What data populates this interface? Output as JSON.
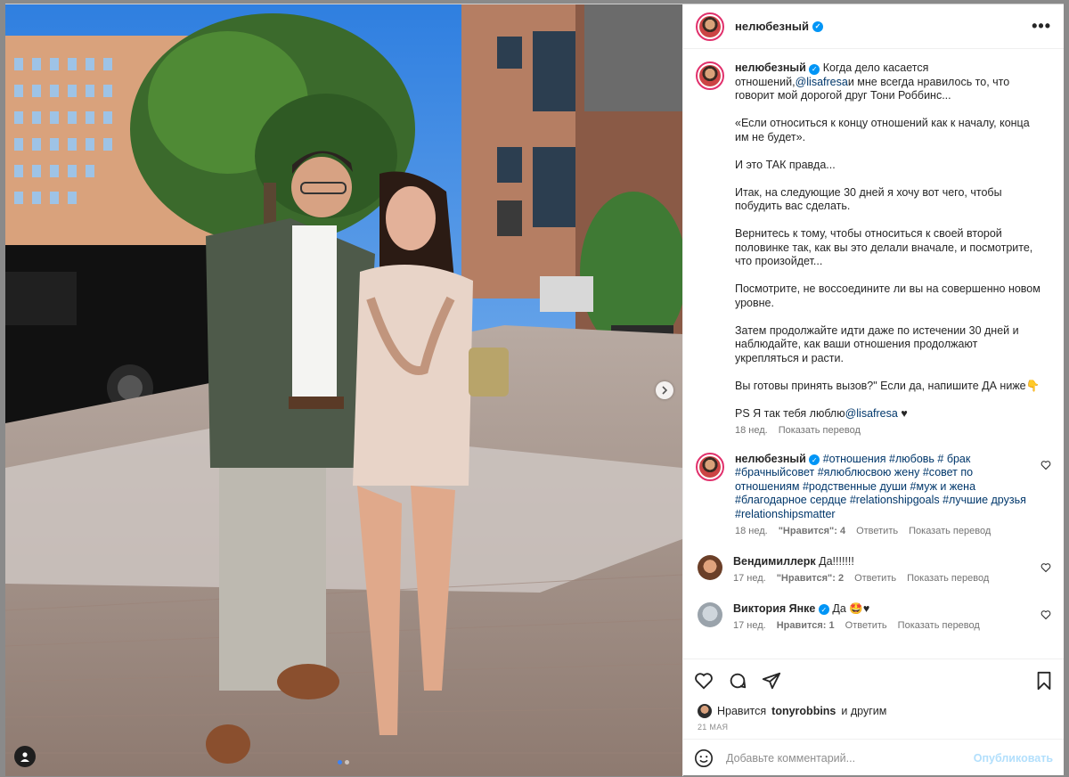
{
  "post": {
    "author": "нелюбезный",
    "more_label": "•••"
  },
  "caption": {
    "author": "нелюбезный",
    "intro": "Когда дело касается отношений,",
    "mention1": "@lisafresa",
    "intro_rest": "и мне всегда нравилось то, что говорит мой дорогой друг Тони Роббинс...",
    "p2": "«Если относиться к концу отношений как к началу, конца им не будет».",
    "p3": "И это ТАК правда...",
    "p4": "Итак, на следующие 30 дней я хочу вот чего, чтобы побудить вас сделать.",
    "p5": "Вернитесь к тому, чтобы относиться к своей второй половинке так, как вы это делали вначале, и посмотрите, что произойдет...",
    "p6": "Посмотрите, не воссоедините ли вы на совершенно новом уровне.",
    "p7": "Затем продолжайте идти даже по истечении 30 дней и наблюдайте, как ваши отношения продолжают укрепляться и расти.",
    "p8": "Вы готовы принять вызов?\" Если да, напишите ДА ниже👇",
    "ps_prefix": "PS Я так тебя люблю",
    "ps_mention": "@lisafresa",
    "ps_suffix": " ♥",
    "time": "18 нед.",
    "translate": "Показать перевод"
  },
  "comments": [
    {
      "author": "нелюбезный",
      "verified": true,
      "text": "#отношения #любовь # брак #брачныйсовет #ялюблюсвою жену #совет по отношениям #родственные души #муж и жена #благодарное сердце #relationshipgoals #лучшие друзья #relationshipsmatter",
      "time": "18 нед.",
      "likes": "\"Нравится\": 4",
      "reply": "Ответить",
      "translate": "Показать перевод"
    },
    {
      "author": "Вендимиллерк",
      "verified": false,
      "text": "Да!!!!!!!",
      "time": "17 нед.",
      "likes": "\"Нравится\": 2",
      "reply": "Ответить",
      "translate": "Показать перевод"
    },
    {
      "author": "Виктория Янке",
      "verified": true,
      "text": "Да 🤩♥",
      "time": "17 нед.",
      "likes": "Нравится: 1",
      "reply": "Ответить",
      "translate": "Показать перевод"
    }
  ],
  "likes_line": {
    "prefix": "Нравится",
    "user": "tonyrobbins",
    "suffix": "и другим"
  },
  "date": "21 МАЯ",
  "comment_box": {
    "placeholder": "Добавьте комментарий...",
    "post_label": "Опубликовать"
  },
  "colors": {
    "link": "#00376b",
    "verified": "#0095f6",
    "post_disabled": "#b2dffc"
  }
}
